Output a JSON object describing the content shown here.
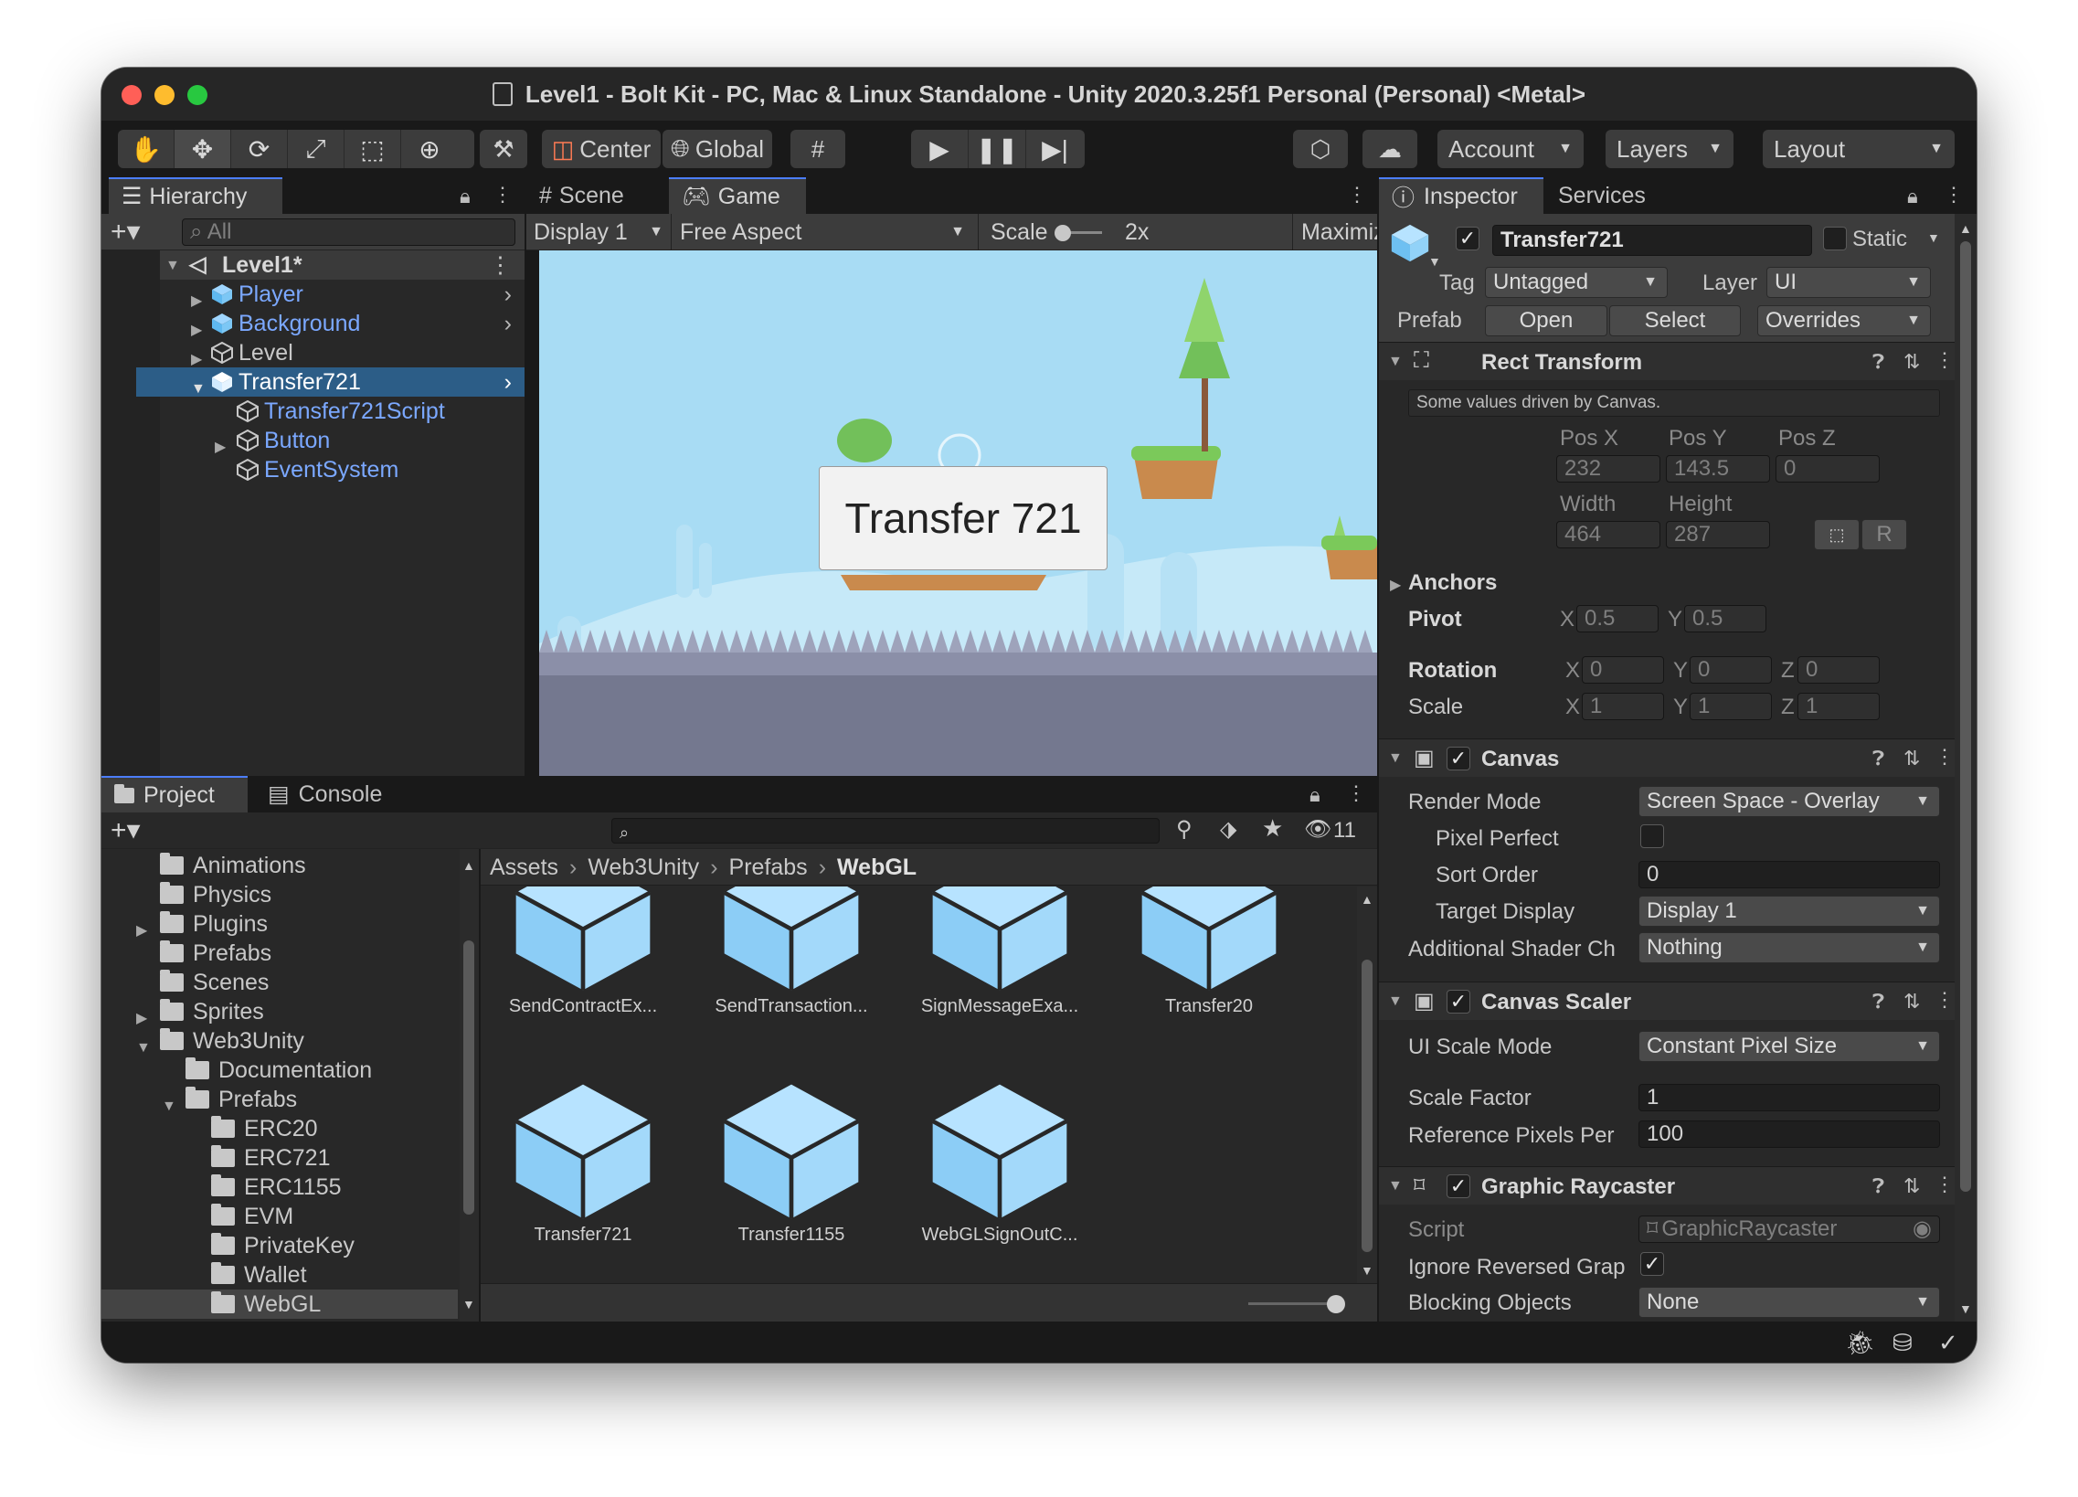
{
  "window": {
    "title": "Level1 - Bolt Kit - PC, Mac & Linux Standalone - Unity 2020.3.25f1 Personal (Personal) <Metal>"
  },
  "toolbar": {
    "center_label": "Center",
    "global_label": "Global",
    "account_label": "Account",
    "layers_label": "Layers",
    "layout_label": "Layout"
  },
  "hierarchy": {
    "tab_label": "Hierarchy",
    "search_placeholder": "All",
    "scene_root": "Level1*",
    "items": [
      "Player",
      "Background",
      "Level",
      "Transfer721",
      "Transfer721Script",
      "Button",
      "EventSystem"
    ]
  },
  "game": {
    "scene_tab": "Scene",
    "game_tab": "Game",
    "display": "Display 1",
    "aspect": "Free Aspect",
    "scale_label": "Scale",
    "scale_value": "2x",
    "maximize": "Maximize On Play",
    "button_text": "Transfer 721"
  },
  "project": {
    "tab_label": "Project",
    "console_label": "Console",
    "hidden_count": "11",
    "tree": [
      "Animations",
      "Physics",
      "Plugins",
      "Prefabs",
      "Scenes",
      "Sprites",
      "Web3Unity",
      "Documentation",
      "Prefabs",
      "ERC20",
      "ERC721",
      "ERC1155",
      "EVM",
      "PrivateKey",
      "Wallet",
      "WebGL"
    ],
    "breadcrumb": [
      "Assets",
      "Web3Unity",
      "Prefabs",
      "WebGL"
    ],
    "assets": [
      "SendContractEx...",
      "SendTransaction...",
      "SignMessageExa...",
      "Transfer20",
      "Transfer721",
      "Transfer1155",
      "WebGLSignOutC..."
    ]
  },
  "inspector": {
    "tab_label": "Inspector",
    "services_label": "Services",
    "object_name": "Transfer721",
    "static_label": "Static",
    "tag_label": "Tag",
    "tag_value": "Untagged",
    "layer_label": "Layer",
    "layer_value": "UI",
    "prefab_label": "Prefab",
    "open_label": "Open",
    "select_label": "Select",
    "overrides_label": "Overrides",
    "rect": {
      "title": "Rect Transform",
      "note": "Some values driven by Canvas.",
      "posx_label": "Pos X",
      "posy_label": "Pos Y",
      "posz_label": "Pos Z",
      "posx": "232",
      "posy": "143.5",
      "posz": "0",
      "width_label": "Width",
      "height_label": "Height",
      "width": "464",
      "height": "287",
      "r_label": "R",
      "anchors": "Anchors",
      "pivot": "Pivot",
      "pivot_x": "0.5",
      "pivot_y": "0.5",
      "rotation": "Rotation",
      "rot_x": "0",
      "rot_y": "0",
      "rot_z": "0",
      "scale": "Scale",
      "sc_x": "1",
      "sc_y": "1",
      "sc_z": "1",
      "x": "X",
      "y": "Y",
      "z": "Z"
    },
    "canvas": {
      "title": "Canvas",
      "render_mode_label": "Render Mode",
      "render_mode": "Screen Space - Overlay",
      "pixel_perfect": "Pixel Perfect",
      "sort_order_label": "Sort Order",
      "sort_order": "0",
      "target_display_label": "Target Display",
      "target_display": "Display 1",
      "shader_label": "Additional Shader Ch",
      "shader_value": "Nothing"
    },
    "scaler": {
      "title": "Canvas Scaler",
      "mode_label": "UI Scale Mode",
      "mode": "Constant Pixel Size",
      "factor_label": "Scale Factor",
      "factor": "1",
      "ref_label": "Reference Pixels Per",
      "ref": "100"
    },
    "raycaster": {
      "title": "Graphic Raycaster",
      "script_label": "Script",
      "script": "GraphicRaycaster",
      "ignore_label": "Ignore Reversed Grap",
      "blocking_label": "Blocking Objects",
      "blocking": "None"
    }
  },
  "colors": {
    "accent": "#4c7eff",
    "selection": "#2c5d87",
    "sky": "#a8dcf4",
    "hierarchy_link": "#7ba8ff"
  }
}
